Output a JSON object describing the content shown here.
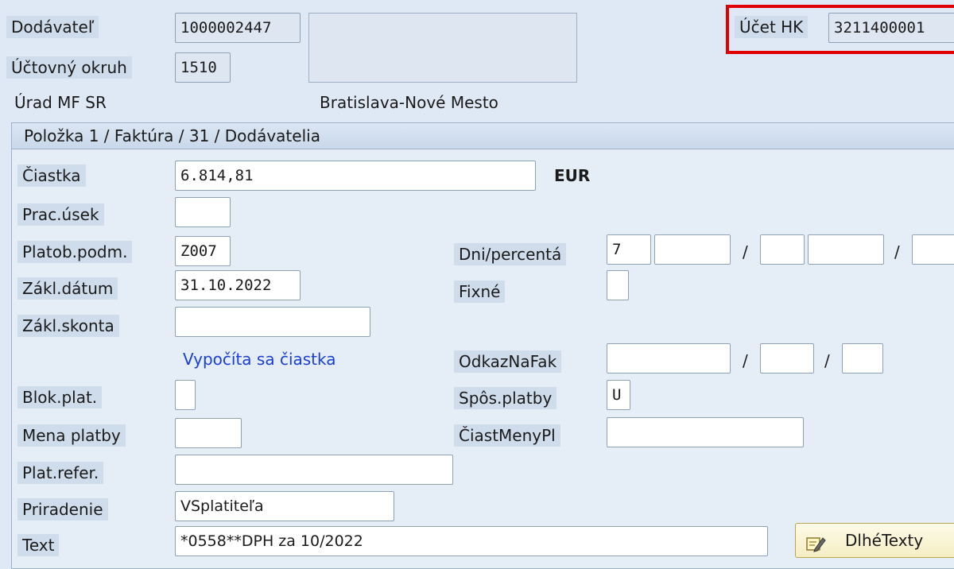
{
  "header": {
    "vendor_label": "Dodávateľ",
    "vendor_value": "1000002447",
    "company_code_label": "Účtovný okruh",
    "company_code_value": "1510",
    "org_name": "Úrad MF SR",
    "city": "Bratislava-Nové Mesto",
    "gl_account_label": "Účet HK",
    "gl_account_value": "3211400001"
  },
  "panel": {
    "title": "Položka 1 / Faktúra / 31 / Dodávatelia"
  },
  "form": {
    "amount_label": "Čiastka",
    "amount_value": "6.814,81",
    "currency": "EUR",
    "business_area_label": "Prac.úsek",
    "business_area_value": "",
    "payment_terms_label": "Platob.podm.",
    "payment_terms_value": "Z007",
    "days_percent_label": "Dni/percentá",
    "days_value_1": "7",
    "base_date_label": "Zákl.dátum",
    "base_date_value": "31.10.2022",
    "fixed_label": "Fixné",
    "discount_base_label": "Zákl.skonta",
    "calculate_amount_link": "Vypočíta sa čiastka",
    "invoice_ref_label": "OdkazNaFak",
    "payment_block_label": "Blok.plat.",
    "payment_method_label": "Spôs.platby",
    "payment_method_value": "U",
    "payment_currency_label": "Mena platby",
    "payment_currency_amount_label": "ČiastMenyPl",
    "payment_reference_label": "Plat.refer.",
    "assignment_label": "Priradenie",
    "assignment_value": "VSplatiteľa",
    "text_label": "Text",
    "text_value": "*0558**DPH za 10/2022",
    "slash": "/"
  },
  "buttons": {
    "long_texts": "DlhéTexty"
  }
}
